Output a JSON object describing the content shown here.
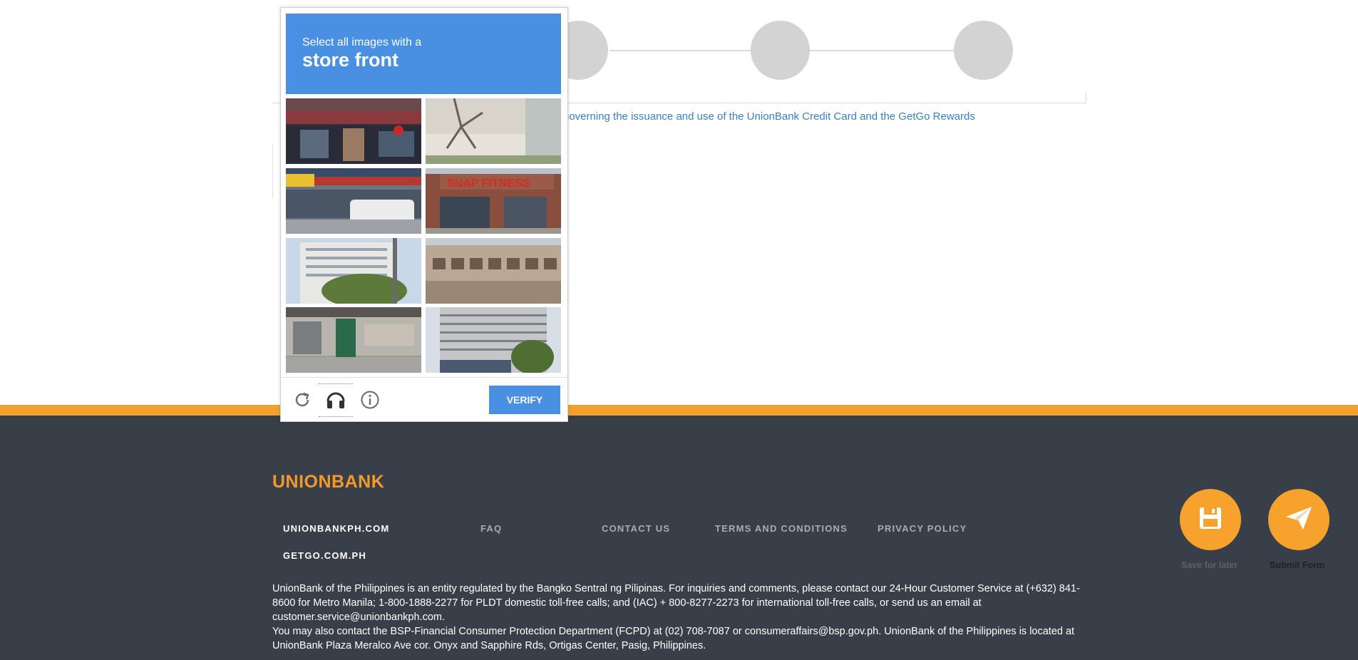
{
  "page": {
    "terms_link_text": "governing the issuance and use of the UnionBank Credit Card and the GetGo Rewards"
  },
  "captcha": {
    "instruction": "Select all images with a",
    "target": "store front",
    "tiles": [
      {
        "scene": "store-front-awning"
      },
      {
        "scene": "tree-and-wall"
      },
      {
        "scene": "street-shops-van"
      },
      {
        "scene": "fitness-store-front"
      },
      {
        "scene": "apartment-building"
      },
      {
        "scene": "building-windows"
      },
      {
        "scene": "bus-stop"
      },
      {
        "scene": "tall-building"
      }
    ],
    "verify_label": "VERIFY",
    "icons": {
      "reload": "reload-icon",
      "audio": "headphones-icon",
      "info": "info-icon"
    },
    "accent_color": "#4a90e2"
  },
  "footer": {
    "logo": "UNIONBANK",
    "nav": {
      "unionbankph": "UNIONBANKPH.COM",
      "faq": "FAQ",
      "contact": "CONTACT US",
      "terms": "TERMS AND CONDITIONS",
      "privacy": "PRIVACY POLICY",
      "getgo": "GETGO.COM.PH"
    },
    "para1": "UnionBank of the Philippines is an entity regulated by the Bangko Sentral ng Pilipinas. For inquiries and comments, please contact our 24-Hour Customer Service at (+632) 841-8600 for Metro Manila; 1-800-1888-2277 for PLDT domestic toll-free calls; and (IAC) + 800-8277-2273 for international toll-free calls, or send us an email at customer.service@unionbankph.com.",
    "para2": "You may also contact the BSP-Financial Consumer Protection Department (FCPD) at (02) 708-7087 or consumeraffairs@bsp.gov.ph. UnionBank of the Philippines is located at UnionBank Plaza Meralco Ave cor. Onyx and Sapphire Rds, Ortigas Center, Pasig, Philippines.",
    "band_color": "#f2a22a",
    "bg_color": "#393f48"
  },
  "actions": {
    "save_label": "Save for later",
    "submit_label": "Submit Form",
    "save_icon": "floppy-disk-icon",
    "submit_icon": "paper-plane-icon"
  }
}
